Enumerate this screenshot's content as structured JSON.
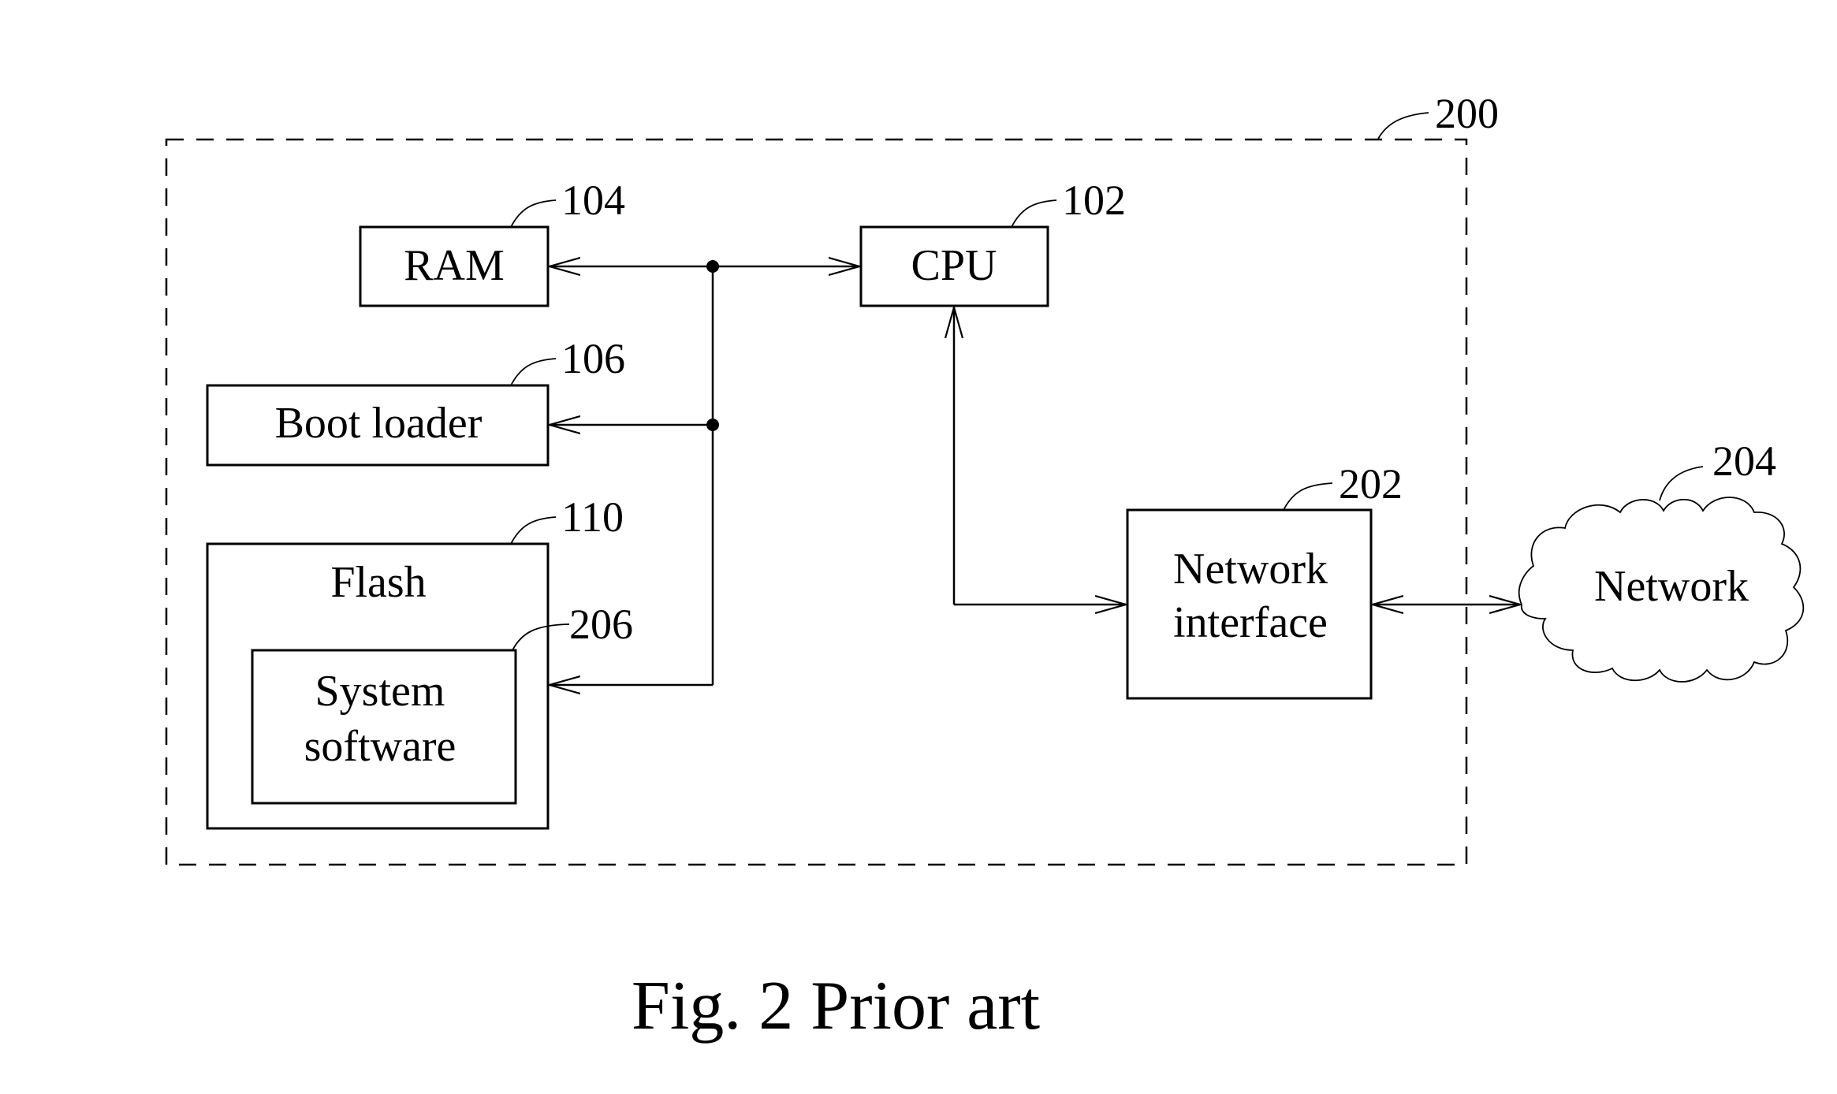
{
  "figure": {
    "caption": "Fig. 2 Prior art",
    "system_ref": "200"
  },
  "blocks": {
    "ram": {
      "label": "RAM",
      "ref": "104"
    },
    "cpu": {
      "label": "CPU",
      "ref": "102"
    },
    "boot_loader": {
      "label": "Boot loader",
      "ref": "106"
    },
    "flash": {
      "label": "Flash",
      "ref": "110"
    },
    "system_software": {
      "label_line1": "System",
      "label_line2": "software",
      "ref": "206"
    },
    "network_interface": {
      "label_line1": "Network",
      "label_line2": "interface",
      "ref": "202"
    },
    "network": {
      "label": "Network",
      "ref": "204"
    }
  },
  "connections": [
    {
      "from": "bus",
      "to": "RAM",
      "arrow": "to RAM"
    },
    {
      "from": "bus",
      "to": "CPU",
      "arrow": "to CPU"
    },
    {
      "from": "bus",
      "to": "Boot loader",
      "arrow": "to Boot loader"
    },
    {
      "from": "bus",
      "to": "Flash",
      "arrow": "to Flash"
    },
    {
      "from": "CPU",
      "to": "Network interface",
      "arrow": "both"
    },
    {
      "from": "Network interface",
      "to": "Network",
      "arrow": "both"
    }
  ]
}
